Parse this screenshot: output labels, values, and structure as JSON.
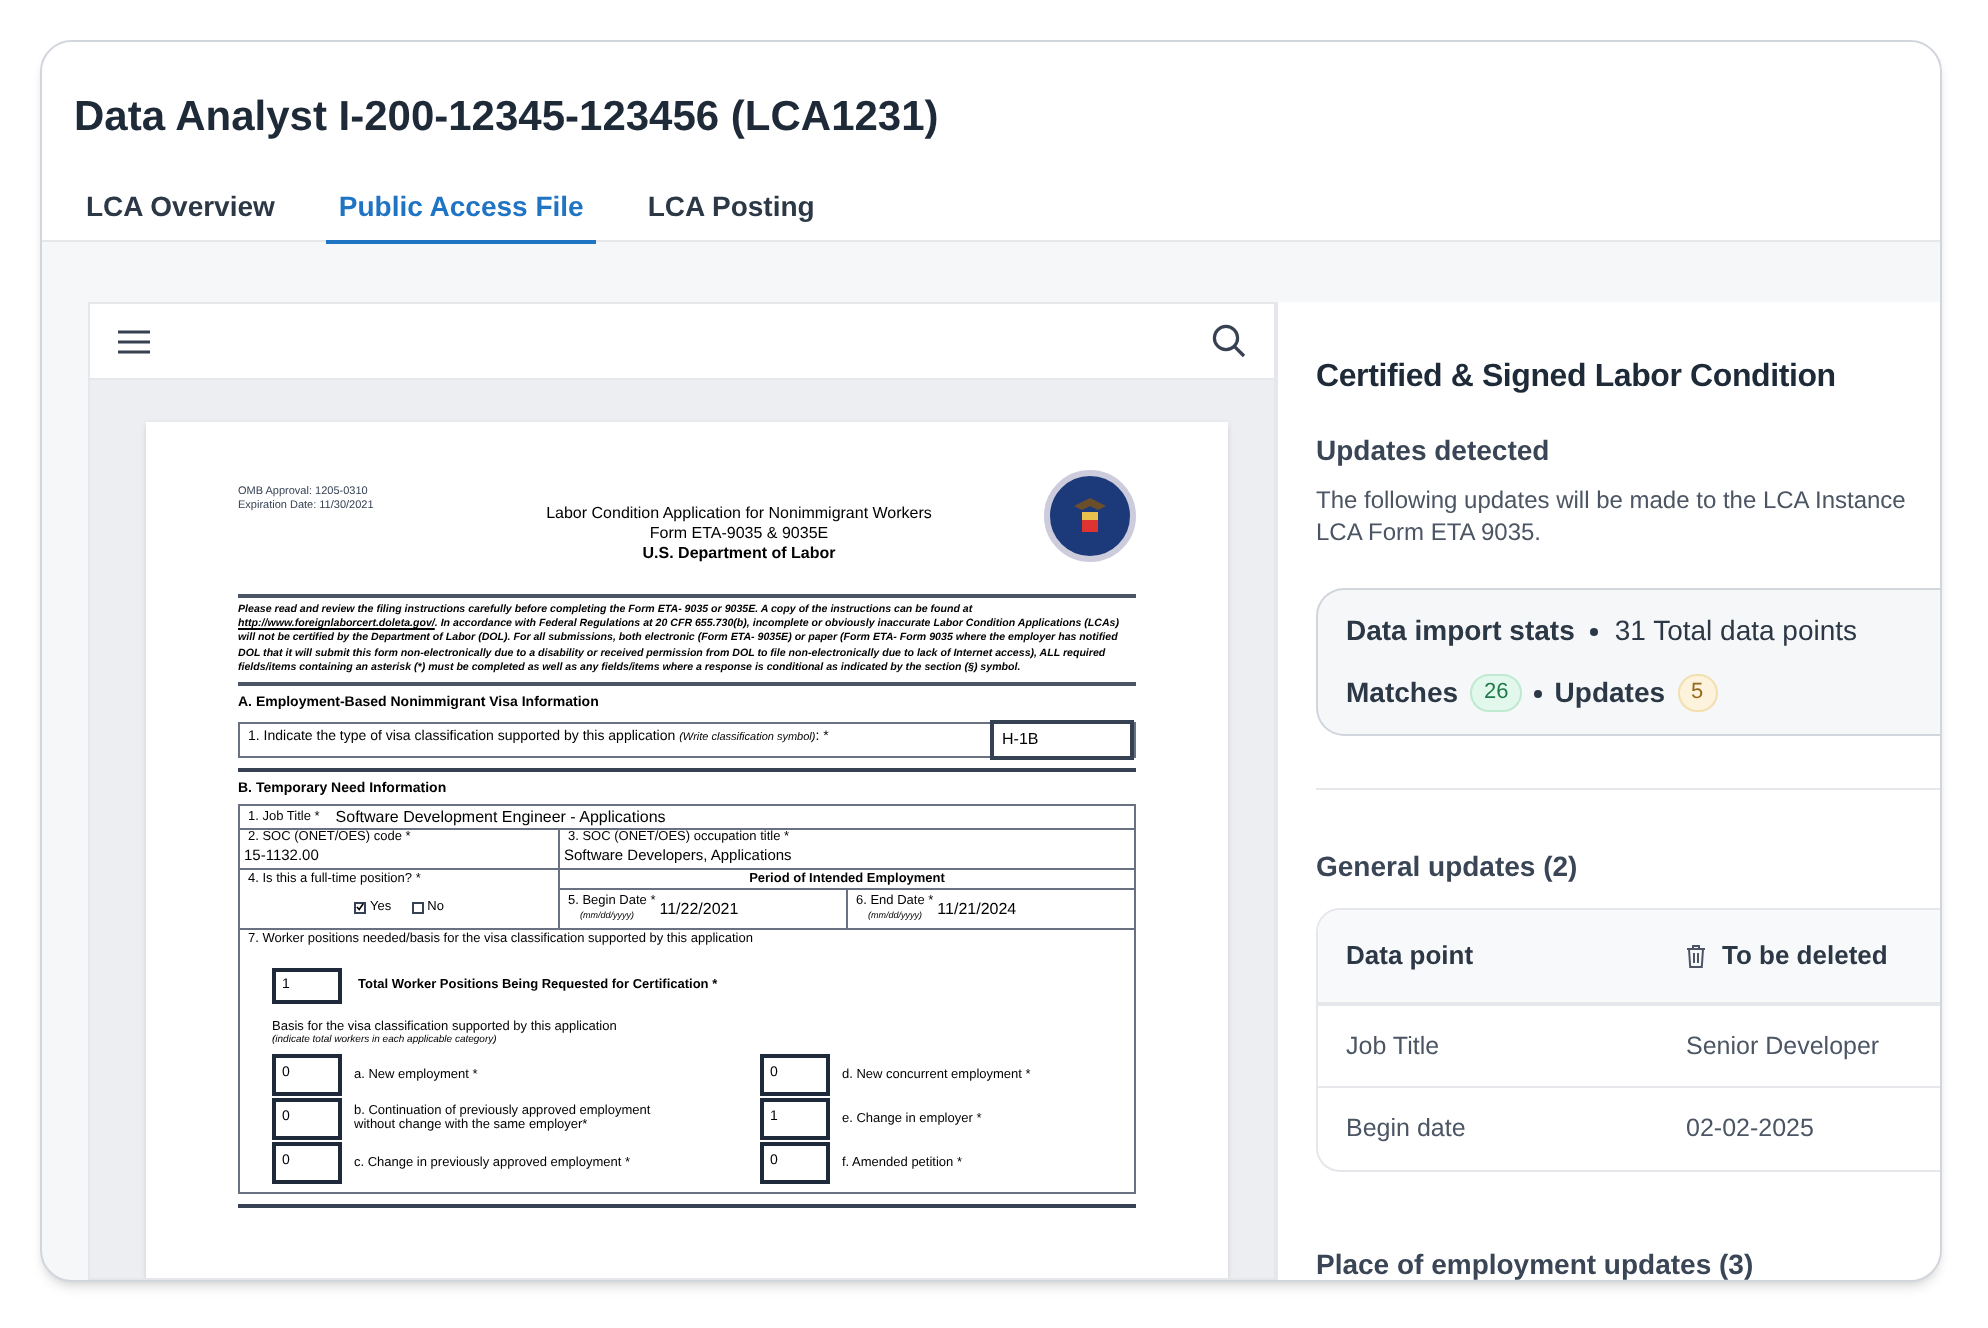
{
  "page_title": "Data Analyst I-200-12345-123456 (LCA1231)",
  "tabs": [
    {
      "label": "LCA Overview",
      "selected": false
    },
    {
      "label": "Public Access File",
      "selected": true
    },
    {
      "label": "LCA Posting",
      "selected": false
    }
  ],
  "document": {
    "omb": [
      "OMB Approval: 1205-0310",
      "Expiration Date: 11/30/2021"
    ],
    "title": [
      "Labor Condition Application for Nonimmigrant Workers",
      "Form ETA-9035 & 9035E",
      "U.S. Department of Labor"
    ],
    "instructions": {
      "before": "Please read and review the filing instructions carefully before completing the Form ETA- 9035 or 9035E.  A copy of the instructions can be found at ",
      "link": "http://www.foreignlaborcert.doleta.gov/",
      "after": ".  In accordance with Federal Regulations at 20 CFR 655.730(b), incomplete or obviously inaccurate Labor Condition Applications (LCAs) will not be certified by the Department of Labor (DOL).  For all submissions, both electronic (Form ETA- 9035E) or paper (Form ETA- Form 9035 where the employer has notified DOL that it will submit this form non-electronically due to a disability or received permission from DOL to file non-electronically due to lack of Internet access), ALL required fields/items containing an asterisk (*) must be completed as well as any fields/items where a response is conditional as indicated by the section (§) symbol."
    },
    "section_a": {
      "heading": "A.  Employment-Based Nonimmigrant Visa Information",
      "label": "1.  Indicate the type of visa classification supported by this application",
      "hint": "(Write classification symbol)",
      "suffix": ": *",
      "value": "H-1B"
    },
    "section_b": {
      "heading": "B.  Temporary Need Information",
      "job_title_label": "1.  Job Title *",
      "job_title": "Software Development Engineer - Applications",
      "soc_code_label": "2.  SOC (ONET/OES) code *",
      "soc_code": "15-1132.00",
      "soc_title_label": "3.  SOC (ONET/OES) occupation title *",
      "soc_title": "Software Developers, Applications",
      "full_time_label": "4.  Is this a full-time position? *",
      "full_time_options": [
        {
          "label": "Yes",
          "checked": true
        },
        {
          "label": "No",
          "checked": false
        }
      ],
      "period_heading": "Period of Intended Employment",
      "begin_label": "5.  Begin Date *",
      "begin_hint": "(mm/dd/yyyy)",
      "begin": "11/22/2021",
      "end_label": "6.  End Date *",
      "end_hint": "(mm/dd/yyyy)",
      "end": "11/21/2024",
      "positions_label": "7.  Worker positions needed/basis for the visa classification supported by this application",
      "total_value": "1",
      "total_label": "Total Worker Positions Being Requested for Certification *",
      "basis_label": "Basis for the visa classification supported by this application",
      "basis_hint": "(indicate total workers in each applicable category)",
      "basis_rows": [
        [
          {
            "workers": "0",
            "category": "a. New employment *"
          },
          {
            "workers": "0",
            "category": "d. New concurrent employment *"
          }
        ],
        [
          {
            "workers": "0",
            "category": "b. Continuation of previously approved employment without change with the same employer*"
          },
          {
            "workers": "1",
            "category": "e. Change in employer *"
          }
        ],
        [
          {
            "workers": "0",
            "category": "c. Change in previously approved employment *"
          },
          {
            "workers": "0",
            "category": "f. Amended petition *"
          }
        ]
      ]
    }
  },
  "panel": {
    "title": "Certified & Signed Labor Condition",
    "subtitle": "Updates detected",
    "description": "The following updates will be made to the LCA Instance LCA Form ETA 9035.",
    "stats": {
      "title": "Data import stats",
      "total": "31 Total data points",
      "matches_label": "Matches",
      "matches": "26",
      "updates_label": "Updates",
      "updates": "5"
    },
    "general": {
      "heading": "General updates (2)",
      "columns": [
        "Data point",
        "To be deleted"
      ],
      "rows": [
        [
          "Job Title",
          "Senior Developer"
        ],
        [
          "Begin date",
          "02-02-2025"
        ]
      ]
    },
    "place_heading": "Place of employment updates (3)"
  }
}
